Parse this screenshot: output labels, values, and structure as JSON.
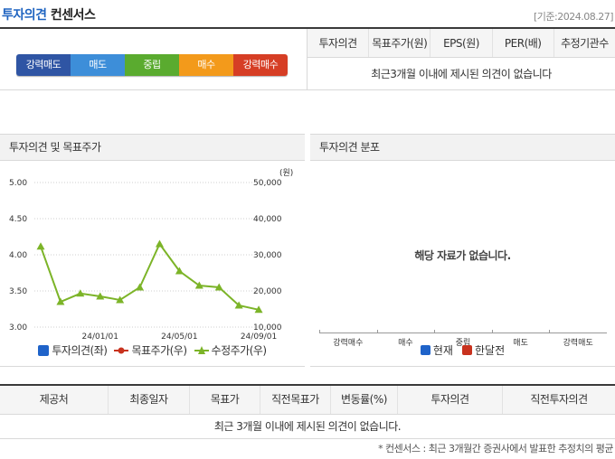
{
  "header": {
    "title_main": "투자의견",
    "title_sub": "컨센서스",
    "date": "[기준:2024.08.27]"
  },
  "opinion_scale": [
    {
      "label": "강력매도",
      "color": "#2f55a4"
    },
    {
      "label": "매도",
      "color": "#3d8ed9"
    },
    {
      "label": "중립",
      "color": "#5aab2f"
    },
    {
      "label": "매수",
      "color": "#f39a1b"
    },
    {
      "label": "강력매수",
      "color": "#d63e25"
    }
  ],
  "consensus_table": {
    "headers": [
      "투자의견",
      "목표주가(원)",
      "EPS(원)",
      "PER(배)",
      "추정기관수"
    ],
    "empty_message": "최근3개월 이내에 제시된 의견이 없습니다"
  },
  "left_panel": {
    "title": "투자의견 및 목표주가",
    "legend": [
      {
        "label": "투자의견(좌)",
        "color": "#1f63c9",
        "marker": "square"
      },
      {
        "label": "목표주가(우)",
        "color": "#c8321e",
        "marker": "circle-line"
      },
      {
        "label": "수정주가(우)",
        "color": "#7cb428",
        "marker": "triangle-line"
      }
    ]
  },
  "right_panel": {
    "title": "투자의견 분포",
    "empty_message": "해당 자료가 없습니다.",
    "categories": [
      "강력매수",
      "매수",
      "중립",
      "매도",
      "강력매도"
    ],
    "legend": [
      {
        "label": "현재",
        "color": "#1f63c9"
      },
      {
        "label": "한달전",
        "color": "#c8321e"
      }
    ]
  },
  "chart_data": {
    "type": "line",
    "left_axis": {
      "ticks": [
        "5.00",
        "4.50",
        "4.00",
        "3.50",
        "3.00"
      ],
      "ylim": [
        3.0,
        5.0
      ]
    },
    "right_axis": {
      "unit": "(원)",
      "ticks": [
        "50,000",
        "40,000",
        "30,000",
        "20,000",
        "10,000"
      ],
      "ylim": [
        10000,
        50000
      ]
    },
    "x_ticks": [
      {
        "label": "24/01/01",
        "x": 3
      },
      {
        "label": "24/05/01",
        "x": 7
      },
      {
        "label": "24/09/01",
        "x": 11
      }
    ],
    "xlim": [
      0,
      11.5
    ],
    "series": [
      {
        "name": "수정주가",
        "axis": "right",
        "color": "#7cb428",
        "x": [
          0,
          1,
          2,
          3,
          4,
          5,
          6,
          7,
          8,
          9,
          10,
          11
        ],
        "values": [
          32300,
          17000,
          19300,
          18500,
          17500,
          21000,
          33000,
          25500,
          21500,
          21000,
          16000,
          14800
        ]
      }
    ]
  },
  "bottom_table": {
    "headers": [
      "제공처",
      "최종일자",
      "목표가",
      "직전목표가",
      "변동률(%)",
      "투자의견",
      "직전투자의견"
    ],
    "empty_message": "최근 3개월 이내에 제시된 의견이 없습니다."
  },
  "footnote": "* 컨센서스 : 최근 3개월간 증권사에서 발표한 추정치의 평균"
}
